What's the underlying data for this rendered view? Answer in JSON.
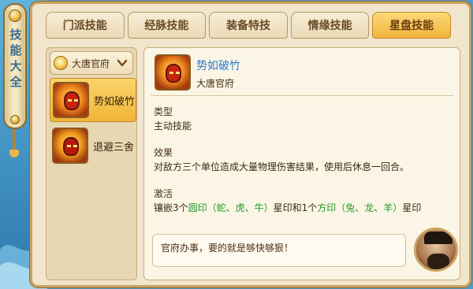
{
  "sidebar_title": "技能大全",
  "tabs": [
    {
      "label": "门派技能",
      "active": false
    },
    {
      "label": "经脉技能",
      "active": false
    },
    {
      "label": "装备特技",
      "active": false
    },
    {
      "label": "情缘技能",
      "active": false
    },
    {
      "label": "星盘技能",
      "active": true
    }
  ],
  "school_select": {
    "label": "大唐官府"
  },
  "skills": [
    {
      "name": "势如破竹",
      "active": true
    },
    {
      "name": "退避三舍",
      "active": false
    }
  ],
  "detail": {
    "name": "势如破竹",
    "school": "大唐官府",
    "type_title": "类型",
    "type_value": "主动技能",
    "effect_title": "效果",
    "effect_text": "对敌方三个单位造成大量物理伤害结果，使用后休息一回合。",
    "activate_title": "激活",
    "activate_pre": "镶嵌3个",
    "activate_green1": "圆印（蛇、虎、牛）",
    "activate_mid": "星印和1个",
    "activate_green2": "方印（兔、龙、羊）",
    "activate_post": "星印"
  },
  "quote": "官府办事，要的就是够快够狠！",
  "colors": {
    "tab_active": "#f1b43d",
    "skill_name_link": "#2b7ad1",
    "highlight_green": "#1f9b2b"
  }
}
